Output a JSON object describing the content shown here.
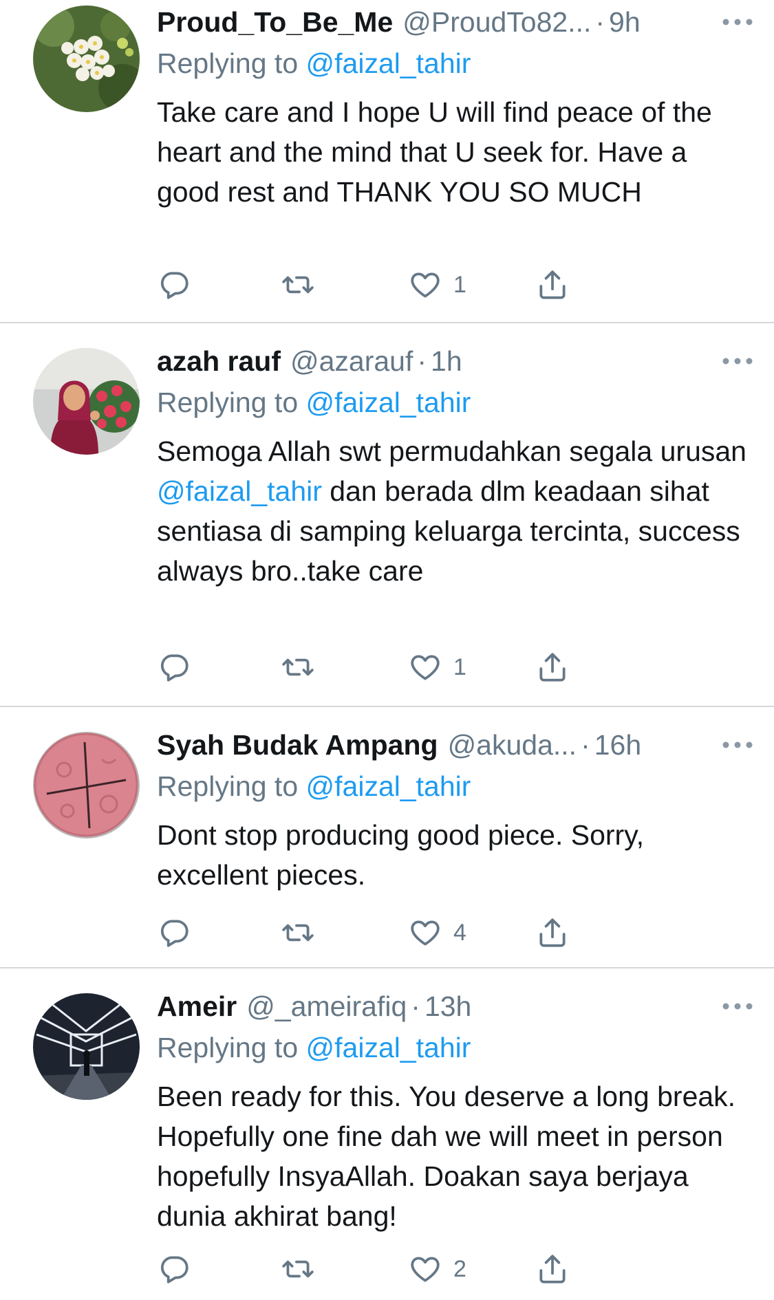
{
  "tweets": [
    {
      "name": "Proud_To_Be_Me",
      "handle": "@ProudTo82...",
      "separator": "·",
      "time": "9h",
      "replying_prefix": "Replying to ",
      "replying_to": "@faizal_tahir",
      "text_before": "Take care and I hope U will find peace of the heart and the mind that U seek for. Have a good rest and THANK YOU SO MUCH",
      "mention": "",
      "text_after": "",
      "likes": "1",
      "avatar": "white-flowers"
    },
    {
      "name": "azah rauf",
      "handle": "@azarauf",
      "separator": "·",
      "time": "1h",
      "replying_prefix": "Replying to ",
      "replying_to": "@faizal_tahir",
      "text_before": "Semoga Allah swt permudahkan segala urusan ",
      "mention": "@faizal_tahir",
      "text_after": " dan berada dlm keadaan sihat sentiasa di samping keluarga tercinta, success always bro..take care",
      "likes": "1",
      "avatar": "woman-with-flowers"
    },
    {
      "name": "Syah Budak Ampang",
      "handle": "@akuda...",
      "separator": "·",
      "time": "16h",
      "replying_prefix": "Replying to ",
      "replying_to": "@faizal_tahir",
      "text_before": "Dont stop producing good piece. Sorry, excellent pieces.",
      "mention": "",
      "text_after": "",
      "likes": "4",
      "avatar": "pink-soap"
    },
    {
      "name": "Ameir",
      "handle": "@_ameirafiq",
      "separator": "·",
      "time": "13h",
      "replying_prefix": "Replying to ",
      "replying_to": "@faizal_tahir",
      "text_before": "Been ready for this. You deserve a long break. Hopefully one fine dah we will meet in person hopefully InsyaAllah. Doakan saya berjaya dunia akhirat bang!",
      "mention": "",
      "text_after": "",
      "likes": "2",
      "avatar": "lit-corridor"
    }
  ],
  "icons": {
    "reply": "reply-icon",
    "retweet": "retweet-icon",
    "like": "heart-icon",
    "share": "share-icon",
    "more": "more-icon"
  },
  "colors": {
    "mention": "#1d9bf0",
    "muted": "#657786",
    "text": "#14171a",
    "divider": "#d7d7db"
  }
}
